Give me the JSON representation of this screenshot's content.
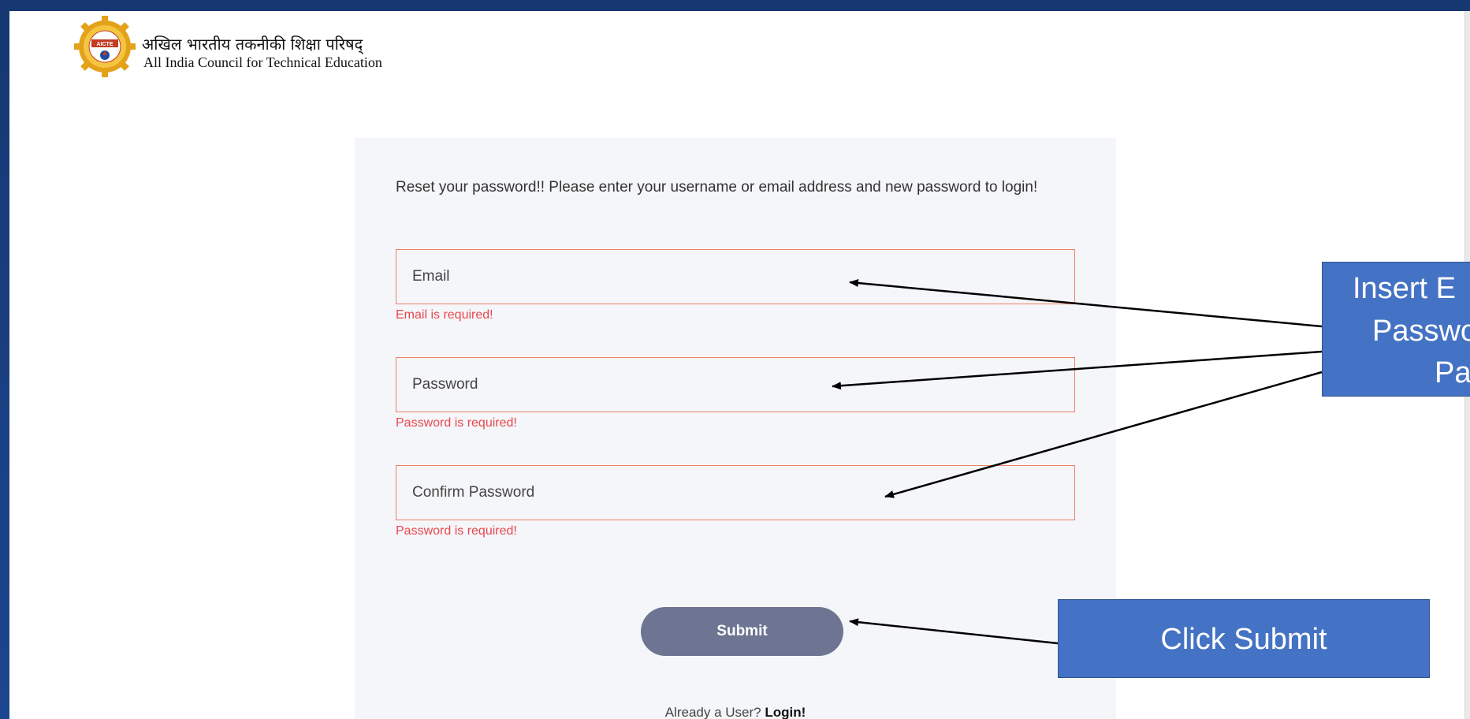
{
  "header": {
    "org_name_hindi": "अखिल भारतीय तकनीकी शिक्षा परिषद्",
    "org_name_english": "All India Council for Technical Education",
    "logo_text": "AICTE"
  },
  "form": {
    "intro_text": "Reset your password!! Please enter your username or email address and new password to login!",
    "email_placeholder": "Email",
    "email_error": "Email is required!",
    "password_placeholder": "Password",
    "password_error": "Password is required!",
    "confirm_placeholder": "Confirm Password",
    "confirm_error": "Password is required!",
    "submit_label": "Submit",
    "already_user_text": "Already a User?",
    "login_link": "Login!"
  },
  "annotations": {
    "callout_insert_line1": "Insert E",
    "callout_insert_line2": "Passwo",
    "callout_insert_line3": "Pa",
    "callout_submit": "Click Submit"
  },
  "colors": {
    "slide_background": "#1b3f86",
    "field_border": "#f0806a",
    "error_text": "#e8474f",
    "submit_button": "#6d7592",
    "callout_fill": "#4472c4"
  }
}
